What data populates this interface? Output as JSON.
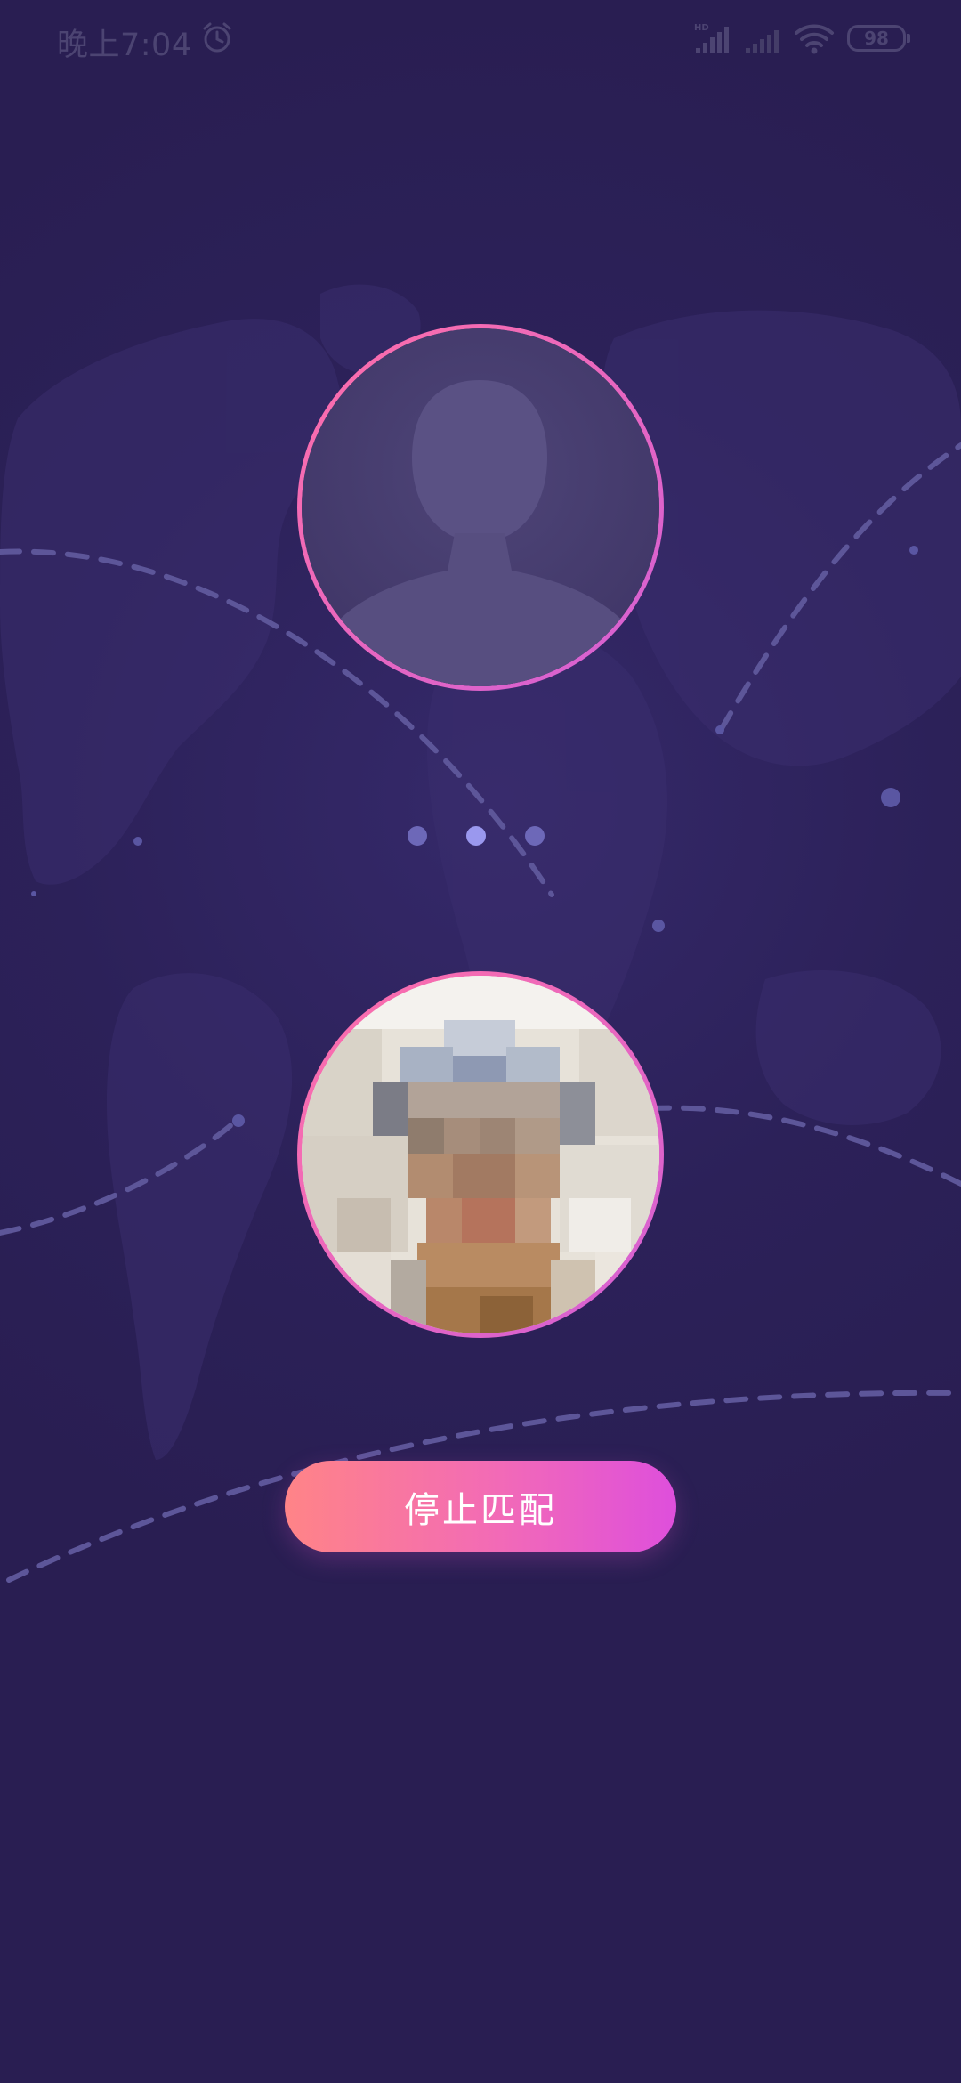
{
  "status_bar": {
    "time": "晚上7:04",
    "battery": "98",
    "icons": [
      "alarm-icon",
      "signal-hd-icon",
      "signal-icon",
      "wifi-icon",
      "battery-icon"
    ]
  },
  "match": {
    "stop_button_label": "停止匹配",
    "partner_avatar": "person-silhouette-icon",
    "self_avatar": "user-photo",
    "loading_dots": 3
  },
  "colors": {
    "background": "#2a1f55",
    "accent_start": "#ff8487",
    "accent_end": "#de4fdc",
    "avatar_ring": "#e061c8",
    "dot_active": "#9a98ee",
    "dot_inactive": "#6d68b8"
  }
}
